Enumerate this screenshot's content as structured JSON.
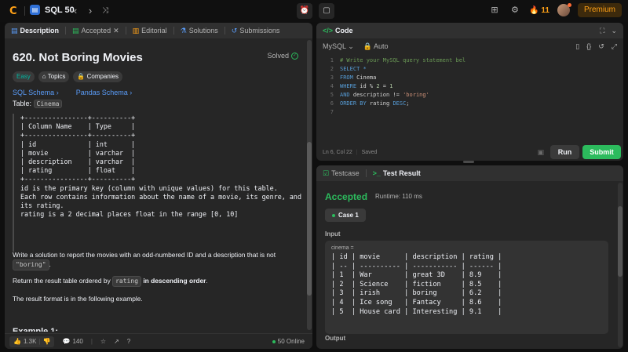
{
  "topbar": {
    "logo_glyph": "Ⅽ",
    "problem_list_title": "SQL 50",
    "streak_count": "11",
    "premium_label": "Premium"
  },
  "left_panel": {
    "tabs": [
      {
        "label": "Description",
        "active": true
      },
      {
        "label": "Accepted",
        "active": false
      },
      {
        "label": "Editorial",
        "active": false
      },
      {
        "label": "Solutions",
        "active": false
      },
      {
        "label": "Submissions",
        "active": false
      }
    ],
    "problem_title": "620. Not Boring Movies",
    "solved_label": "Solved",
    "tags": {
      "difficulty": "Easy",
      "topics": "Topics",
      "companies": "Companies"
    },
    "schema_links": {
      "sql": "SQL Schema",
      "pandas": "Pandas Schema"
    },
    "table_label": "Table:",
    "table_name": "Cinema",
    "schema_text": "+----------------+----------+\n| Column Name    | Type     |\n+----------------+----------+\n| id             | int      |\n| movie          | varchar  |\n| description    | varchar  |\n| rating         | float    |\n+----------------+----------+\nid is the primary key (column with unique values) for this table.\nEach row contains information about the name of a movie, its genre, and\nits rating.\nrating is a 2 decimal places float in the range [0, 10]",
    "para1_a": "Write a solution to report the movies with an odd-numbered ID and a description that is not",
    "para1_code": "\"boring\"",
    "para1_b": ".",
    "para2_a": "Return the result table ordered by",
    "para2_code": "rating",
    "para2_b": "in descending order",
    "para2_c": ".",
    "para3": "The result format is in the following example.",
    "cut_heading": "Example 1:",
    "bottom": {
      "likes": "1.3K",
      "comments": "140",
      "online": "50 Online"
    }
  },
  "code_panel": {
    "title": "Code",
    "language": "MySQL",
    "mode": "Auto",
    "lines": [
      {
        "n": "1",
        "text": "# Write your MySQL query statement bel"
      },
      {
        "n": "2",
        "text": "SELECT *"
      },
      {
        "n": "3",
        "text": "FROM Cinema"
      },
      {
        "n": "4",
        "text": "WHERE id % 2 = 1"
      },
      {
        "n": "5",
        "text": "AND description != 'boring'"
      },
      {
        "n": "6",
        "text": "ORDER BY rating DESC;"
      },
      {
        "n": "7",
        "text": ""
      }
    ],
    "cursor_pos": "Ln 6, Col 22",
    "saved_status": "Saved",
    "run_label": "Run",
    "submit_label": "Submit"
  },
  "result_panel": {
    "tabs": [
      {
        "label": "Testcase",
        "active": false
      },
      {
        "label": "Test Result",
        "active": true
      }
    ],
    "status": "Accepted",
    "runtime": "Runtime: 110 ms",
    "case_label": "Case 1",
    "input_label": "Input",
    "var_name": "cinema =",
    "input_table": "| id | movie      | description | rating |\n| -- | ---------- | ----------- | ------ |\n| 1  | War        | great 3D    | 8.9    |\n| 2  | Science    | fiction     | 8.5    |\n| 3  | irish      | boring      | 6.2    |\n| 4  | Ice song   | Fantacy     | 8.6    |\n| 5  | House card | Interesting | 9.1    |",
    "output_label": "Output"
  },
  "colors": {
    "accent": "#ffa116",
    "success": "#2cbb5d",
    "link": "#5a9cf8",
    "panel_bg": "#262626",
    "page_bg": "#0f0f0f"
  }
}
